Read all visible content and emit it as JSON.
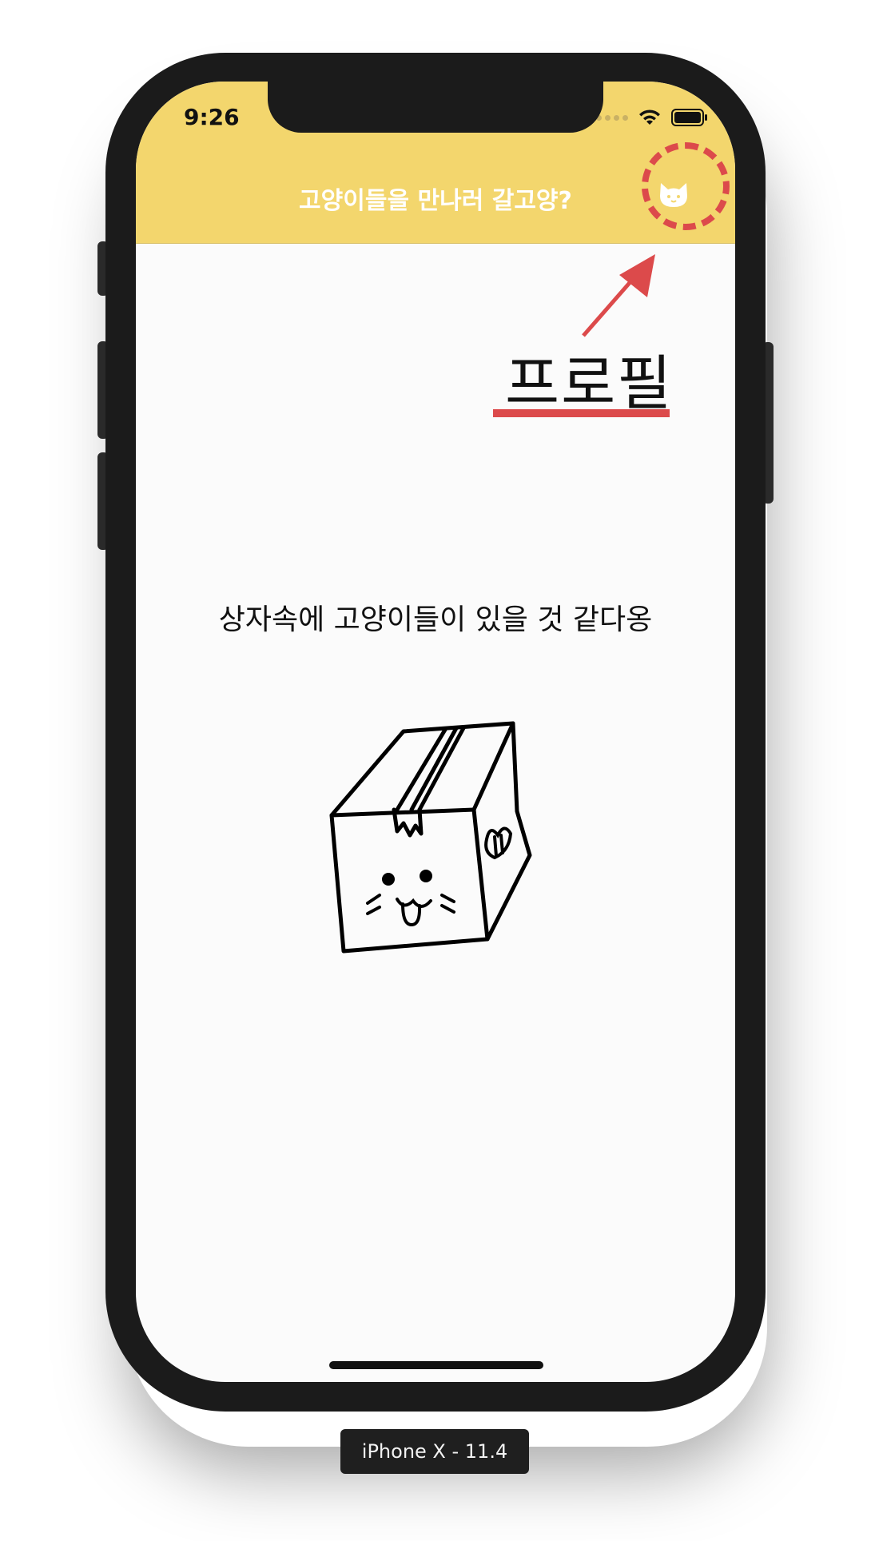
{
  "status_bar": {
    "time": "9:26"
  },
  "navbar": {
    "title": "고양이들을 만나러 갈고양?",
    "profile_icon": "cat-face-icon"
  },
  "annotation": {
    "label": "프로필",
    "accent_color": "#dc4a4b"
  },
  "content": {
    "subtitle": "상자속에 고양이들이 있을 것 같다옹",
    "illustration": "cat-box-drawing"
  },
  "device": {
    "label": "iPhone X - 11.4"
  },
  "colors": {
    "navbar": "#f3d66d",
    "background": "#fbfbfb",
    "device_frame": "#1b1b1b"
  }
}
